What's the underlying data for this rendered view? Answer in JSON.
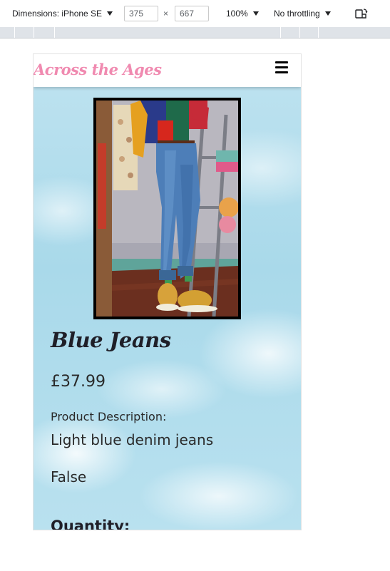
{
  "devtools": {
    "device_label": "Dimensions: iPhone SE",
    "width_value": "375",
    "times": "×",
    "height_value": "667",
    "zoom_label": "100%",
    "throttle_label": "No throttling"
  },
  "site": {
    "brand": "Across the Ages",
    "menu_icon": "hamburger-icon"
  },
  "product": {
    "title": "Blue Jeans",
    "price": "£37.99",
    "description_label": "Product Description:",
    "description": "Light blue denim jeans",
    "flag_value": "False",
    "quantity_label": "Quantity:"
  },
  "colors": {
    "brand_pink": "#f08ab0",
    "sky_blue": "#a9d9ea",
    "title_dark": "#1f1f28"
  }
}
